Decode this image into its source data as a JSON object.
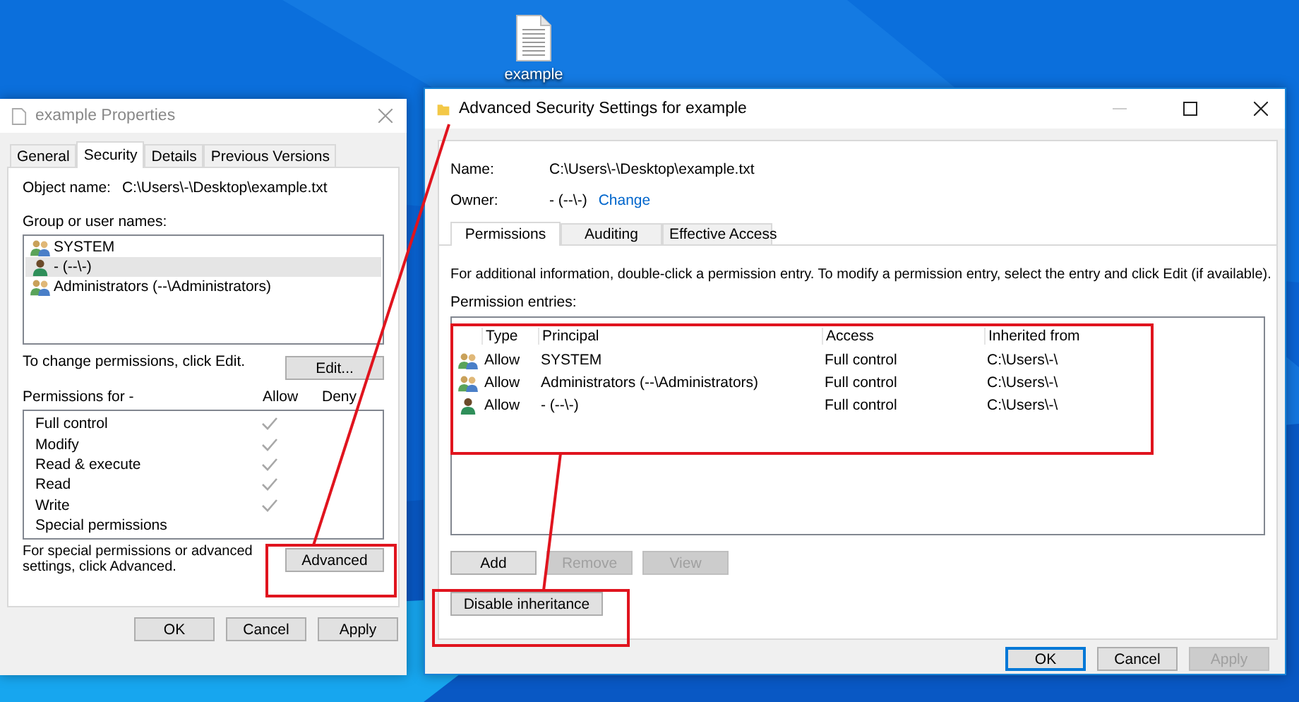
{
  "desktop_icon": {
    "label": "example"
  },
  "properties_window": {
    "title": "example Properties",
    "tabs": [
      {
        "label": "General",
        "selected": false
      },
      {
        "label": "Security",
        "selected": true
      },
      {
        "label": "Details",
        "selected": false
      },
      {
        "label": "Previous Versions",
        "selected": false
      }
    ],
    "object_name_label": "Object name:",
    "object_name": "C:\\Users\\-\\Desktop\\example.txt",
    "group_label": "Group or user names:",
    "users": [
      {
        "name": "SYSTEM",
        "kind": "group",
        "selected": false
      },
      {
        "name": "- (--\\-)",
        "kind": "user",
        "selected": true
      },
      {
        "name": "Administrators (--\\Administrators)",
        "kind": "group",
        "selected": false
      }
    ],
    "edit_hint": "To change permissions, click Edit.",
    "edit_button": "Edit...",
    "permissions_label": "Permissions for -",
    "allow_header": "Allow",
    "deny_header": "Deny",
    "permissions": [
      {
        "name": "Full control",
        "allow": true
      },
      {
        "name": "Modify",
        "allow": true
      },
      {
        "name": "Read & execute",
        "allow": true
      },
      {
        "name": "Read",
        "allow": true
      },
      {
        "name": "Write",
        "allow": true
      },
      {
        "name": "Special permissions",
        "allow": false
      }
    ],
    "advanced_hint": "For special permissions or advanced settings, click Advanced.",
    "advanced_button": "Advanced",
    "buttons": [
      {
        "label": "OK",
        "disabled": false
      },
      {
        "label": "Cancel",
        "disabled": false
      },
      {
        "label": "Apply",
        "disabled": false
      }
    ]
  },
  "advanced_window": {
    "title": "Advanced Security Settings for example",
    "name_label": "Name:",
    "name": "C:\\Users\\-\\Desktop\\example.txt",
    "owner_label": "Owner:",
    "owner": "- (--\\-)",
    "change_link": "Change",
    "tabs": [
      {
        "label": "Permissions",
        "selected": true
      },
      {
        "label": "Auditing",
        "selected": false
      },
      {
        "label": "Effective Access",
        "selected": false
      }
    ],
    "info": "For additional information, double-click a permission entry. To modify a permission entry, select the entry and click Edit (if available).",
    "entries_label": "Permission entries:",
    "columns": [
      "Type",
      "Principal",
      "Access",
      "Inherited from"
    ],
    "rows": [
      {
        "kind": "group",
        "type": "Allow",
        "principal": "SYSTEM",
        "access": "Full control",
        "inherited_from": "C:\\Users\\-\\"
      },
      {
        "kind": "group",
        "type": "Allow",
        "principal": "Administrators (--\\Administrators)",
        "access": "Full control",
        "inherited_from": "C:\\Users\\-\\"
      },
      {
        "kind": "user",
        "type": "Allow",
        "principal": "- (--\\-)",
        "access": "Full control",
        "inherited_from": "C:\\Users\\-\\"
      }
    ],
    "entry_buttons": [
      {
        "label": "Add",
        "disabled": false
      },
      {
        "label": "Remove",
        "disabled": true
      },
      {
        "label": "View",
        "disabled": true
      }
    ],
    "inheritance_button": "Disable inheritance",
    "buttons": [
      {
        "label": "OK",
        "disabled": false,
        "default": true
      },
      {
        "label": "Cancel",
        "disabled": false,
        "default": false
      },
      {
        "label": "Apply",
        "disabled": true,
        "default": false
      }
    ]
  }
}
